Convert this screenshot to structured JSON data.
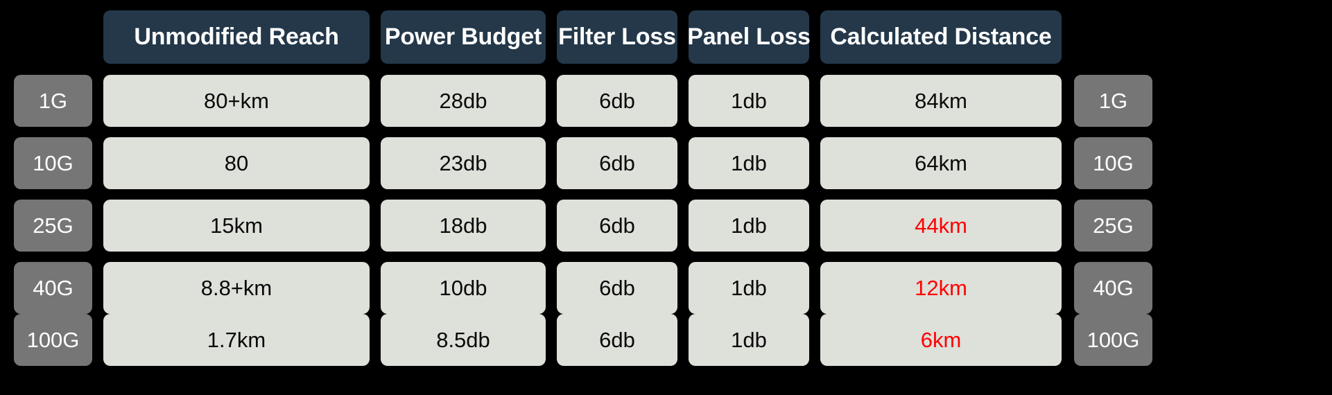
{
  "table": {
    "corner_label": "",
    "column_headers": [
      "Unmodified Reach",
      "Power Budget",
      "Filter Loss",
      "Panel Loss",
      "Calculated Distance"
    ],
    "row_labels": [
      "1G",
      "10G",
      "25G",
      "40G",
      "100G"
    ],
    "row_labels_right": [
      "1G",
      "10G",
      "25G",
      "40G",
      "100G"
    ],
    "rows": [
      {
        "label": "1G",
        "unmodified_reach": "80+km",
        "power_budget": "28db",
        "filter_loss": "6db",
        "panel_loss": "1db",
        "calculated_distance": "84km",
        "calculated_distance_alert": false
      },
      {
        "label": "10G",
        "unmodified_reach": "80",
        "power_budget": "23db",
        "filter_loss": "6db",
        "panel_loss": "1db",
        "calculated_distance": "64km",
        "calculated_distance_alert": false
      },
      {
        "label": "25G",
        "unmodified_reach": "15km",
        "power_budget": "18db",
        "filter_loss": "6db",
        "panel_loss": "1db",
        "calculated_distance": "44km",
        "calculated_distance_alert": true
      },
      {
        "label": "40G",
        "unmodified_reach": "8.8+km",
        "power_budget": "10db",
        "filter_loss": "6db",
        "panel_loss": "1db",
        "calculated_distance": "12km",
        "calculated_distance_alert": true
      },
      {
        "label": "100G",
        "unmodified_reach": "1.7km",
        "power_budget": "8.5db",
        "filter_loss": "6db",
        "panel_loss": "1db",
        "calculated_distance": "6km",
        "calculated_distance_alert": true
      }
    ]
  },
  "colors": {
    "background": "#000000",
    "header_bg": "#24384a",
    "header_text": "#ffffff",
    "cell_bg": "#dee0da",
    "cell_text": "#0a0a0a",
    "row_label_bg": "#767676",
    "row_label_text": "#ffffff",
    "alert_text": "#ff0000"
  }
}
